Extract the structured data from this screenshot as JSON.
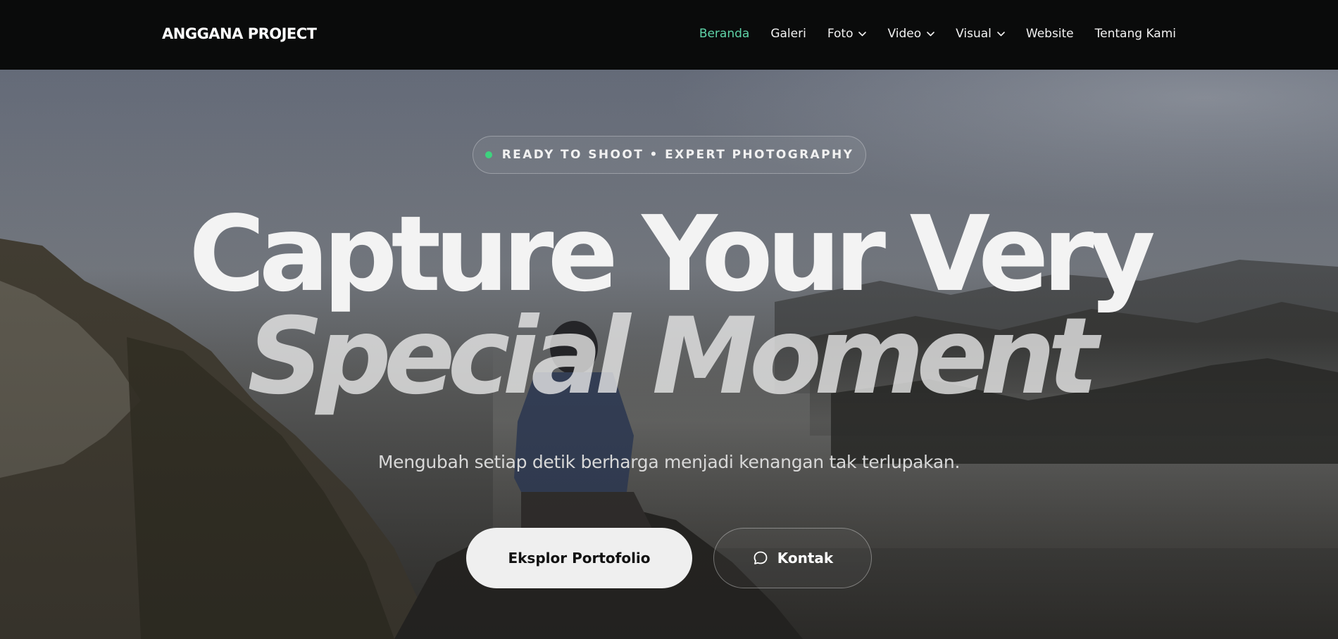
{
  "brand": {
    "name": "ANGGANA PROJECT"
  },
  "nav": {
    "items": [
      {
        "label": "Beranda",
        "active": true,
        "dropdown": false
      },
      {
        "label": "Galeri",
        "active": false,
        "dropdown": false
      },
      {
        "label": "Foto",
        "active": false,
        "dropdown": true
      },
      {
        "label": "Video",
        "active": false,
        "dropdown": true
      },
      {
        "label": "Visual",
        "active": false,
        "dropdown": true
      },
      {
        "label": "Website",
        "active": false,
        "dropdown": false
      },
      {
        "label": "Tentang Kami",
        "active": false,
        "dropdown": false
      }
    ]
  },
  "hero": {
    "badge": "READY TO SHOOT • EXPERT PHOTOGRAPHY",
    "title_line1": "Capture Your Very",
    "title_line2": "Special Moment",
    "subtitle": "Mengubah setiap detik berharga menjadi kenangan tak terlupakan.",
    "primary_button": "Eksplor Portofolio",
    "secondary_button": "Kontak",
    "secondary_icon": "chat-bubble-icon"
  },
  "colors": {
    "accent": "#5fd4a8",
    "status_dot": "#3ed37e",
    "nav_bg": "#0a0b0b"
  }
}
